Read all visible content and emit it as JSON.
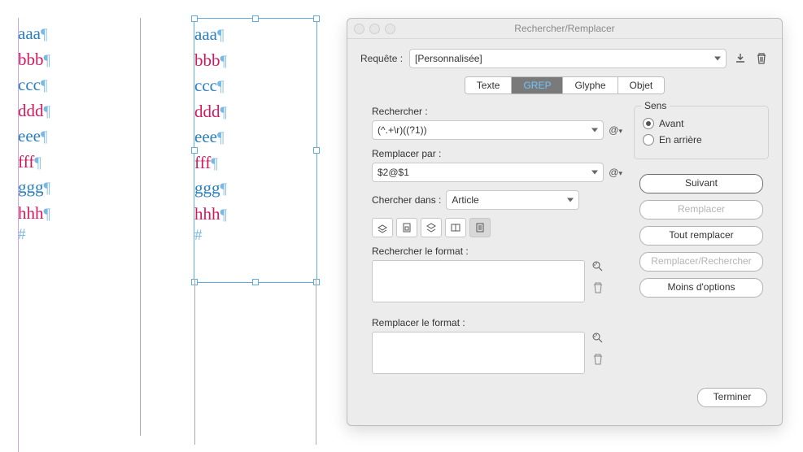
{
  "frame1": {
    "lines": [
      {
        "text": "aaa",
        "cls": "blue"
      },
      {
        "text": "bbb",
        "cls": "pink"
      },
      {
        "text": "ccc",
        "cls": "blue"
      },
      {
        "text": "ddd",
        "cls": "pink"
      },
      {
        "text": "eee",
        "cls": "blue"
      },
      {
        "text": "fff",
        "cls": "pink"
      },
      {
        "text": "ggg",
        "cls": "blue"
      },
      {
        "text": "hhh",
        "cls": "pink"
      }
    ],
    "end": "#"
  },
  "frame2": {
    "lines": [
      {
        "text": "aaa",
        "cls": "blue"
      },
      {
        "text": "bbb",
        "cls": "pink"
      },
      {
        "text": "ccc",
        "cls": "blue"
      },
      {
        "text": "ddd",
        "cls": "pink"
      },
      {
        "text": "eee",
        "cls": "blue"
      },
      {
        "text": "fff",
        "cls": "pink"
      },
      {
        "text": "ggg",
        "cls": "blue"
      },
      {
        "text": "hhh",
        "cls": "pink"
      }
    ],
    "end": "#"
  },
  "dialog": {
    "title": "Rechercher/Remplacer",
    "query_label": "Requête :",
    "query_value": "[Personnalisée]",
    "tabs": {
      "text": "Texte",
      "grep": "GREP",
      "glyph": "Glyphe",
      "object": "Objet"
    },
    "find_label": "Rechercher :",
    "find_value": "(^.+\\r)((?1))",
    "replace_label": "Remplacer par :",
    "replace_value": "$2@$1",
    "search_in_label": "Chercher dans :",
    "search_in_value": "Article",
    "find_format_label": "Rechercher le format :",
    "change_format_label": "Remplacer le format :",
    "sens": {
      "title": "Sens",
      "forward": "Avant",
      "backward": "En arrière"
    },
    "buttons": {
      "next": "Suivant",
      "change": "Remplacer",
      "change_all": "Tout remplacer",
      "change_find": "Remplacer/Rechercher",
      "fewer": "Moins d'options",
      "done": "Terminer"
    }
  }
}
